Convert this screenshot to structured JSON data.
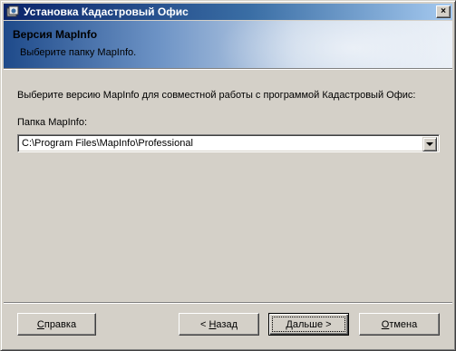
{
  "window": {
    "title": "Установка Кадастровый Офис",
    "close_symbol": "×",
    "icons": [
      "setup-app-icon",
      "close-icon"
    ]
  },
  "header": {
    "title": "Версия MapInfo",
    "subtitle": "Выберите папку MapInfo."
  },
  "main": {
    "instruction": "Выберите версию MapInfo для совместной работы с программой Кадастровый Офис:",
    "folder_label": "Папка MapInfo:",
    "folder_value": "C:\\Program Files\\MapInfo\\Professional"
  },
  "buttons": {
    "help": {
      "mnemonic": "С",
      "rest": "правка"
    },
    "back": {
      "prefix": "< ",
      "mnemonic": "Н",
      "rest": "азад"
    },
    "next": {
      "mnemonic": "Д",
      "rest": "альше >"
    },
    "cancel": {
      "mnemonic": "О",
      "rest": "тмена"
    }
  }
}
